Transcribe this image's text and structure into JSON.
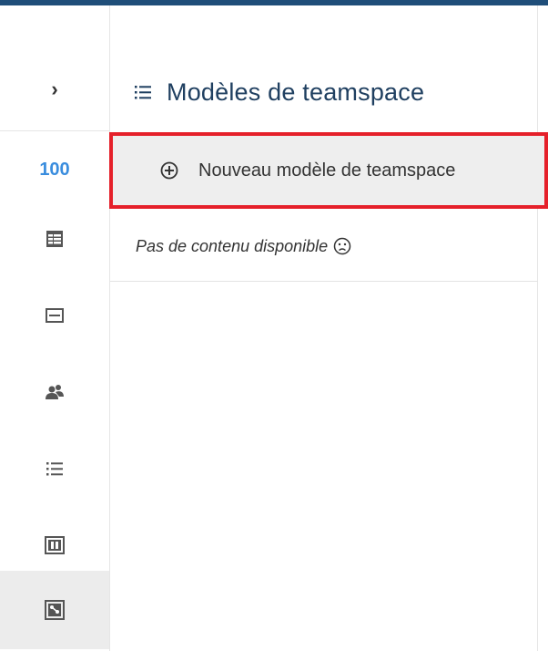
{
  "rail": {
    "count_badge": "100",
    "icons": [
      "chevron-right-icon",
      "table-icon",
      "card-icon",
      "users-icon",
      "list-icon",
      "board-icon",
      "map-icon"
    ],
    "active_item": "map-icon"
  },
  "header": {
    "title": "Modèles de teamspace",
    "icon": "list-icon"
  },
  "new_item": {
    "label": "Nouveau modèle de teamspace",
    "icon": "plus-circle-icon"
  },
  "empty_state": {
    "label": "Pas de contenu disponible",
    "icon": "sad-face-icon"
  },
  "colors": {
    "topbar": "#1f4e79",
    "title": "#1f3f60",
    "count": "#3a8dde",
    "highlight_border": "#e5202a",
    "active_bg": "#ececec"
  }
}
